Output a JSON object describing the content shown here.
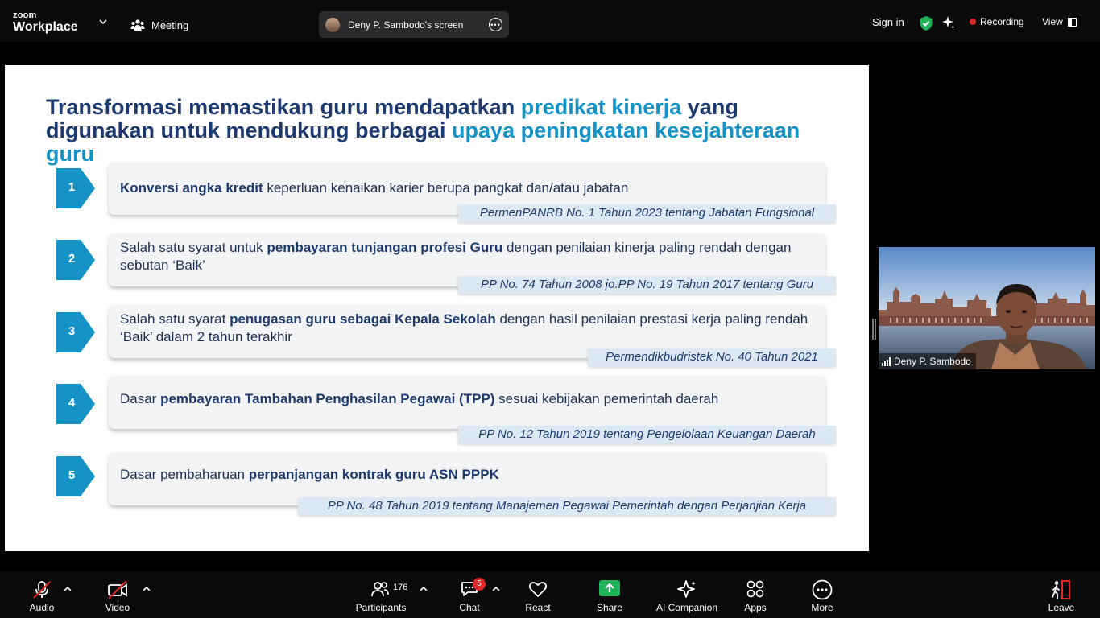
{
  "app": {
    "brand_top": "zoom",
    "brand_bottom": "Workplace"
  },
  "header": {
    "meeting_label": "Meeting",
    "screen_share_label": "Deny P. Sambodo's screen",
    "sign_in": "Sign in",
    "recording": "Recording",
    "view": "View"
  },
  "slide": {
    "title_parts": [
      "Transformasi memastikan guru mendapatkan ",
      "predikat kinerja",
      " yang digunakan untuk mendukung berbagai ",
      "upaya peningkatan kesejahteraan guru"
    ],
    "items": [
      {
        "num": "1",
        "t1": "",
        "b1": "Konversi angka kredit",
        "t2": " keperluan kenaikan karier berupa pangkat dan/atau jabatan",
        "ref": "PermenPANRB No. 1 Tahun 2023 tentang Jabatan Fungsional"
      },
      {
        "num": "2",
        "t1": "Salah satu syarat untuk ",
        "b1": "pembayaran tunjangan profesi Guru",
        "t2": " dengan penilaian kinerja paling rendah dengan sebutan ‘Baik’",
        "ref": "PP No. 74 Tahun 2008 jo.PP No. 19 Tahun 2017 tentang Guru"
      },
      {
        "num": "3",
        "t1": "Salah satu syarat ",
        "b1": "penugasan guru sebagai Kepala Sekolah",
        "t2": " dengan hasil penilaian prestasi kerja paling rendah ‘Baik’ dalam 2 tahun terakhir",
        "ref": "Permendikbudristek No. 40 Tahun 2021"
      },
      {
        "num": "4",
        "t1": "Dasar ",
        "b1": "pembayaran Tambahan Penghasilan Pegawai (TPP)",
        "t2": " sesuai kebijakan pemerintah daerah",
        "ref": "PP No. 12 Tahun 2019 tentang Pengelolaan Keuangan Daerah"
      },
      {
        "num": "5",
        "t1": "Dasar pembaharuan ",
        "b1": "perpanjangan kontrak guru ASN PPPK",
        "t2": "",
        "ref": "PP No. 48 Tahun 2019 tentang Manajemen Pegawai Pemerintah dengan Perjanjian Kerja"
      }
    ]
  },
  "video": {
    "participant_name": "Deny P. Sambodo"
  },
  "toolbar": {
    "audio": "Audio",
    "video": "Video",
    "participants": "Participants",
    "participant_count": "176",
    "chat": "Chat",
    "chat_badge": "5",
    "react": "React",
    "share": "Share",
    "ai_companion": "AI Companion",
    "apps": "Apps",
    "more": "More",
    "leave": "Leave"
  },
  "colors": {
    "title_dark": "#1d3a6e",
    "title_accent": "#1592c6",
    "badge_blue": "#1592c6",
    "share_green": "#1fb35a",
    "recording_red": "#e02828"
  }
}
